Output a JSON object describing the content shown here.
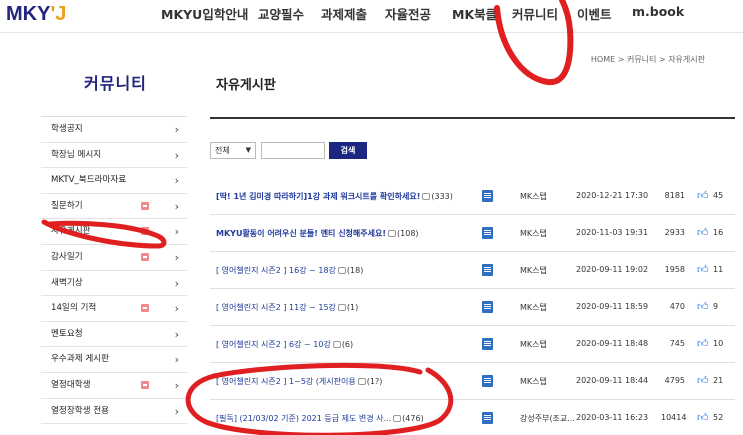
{
  "logo": "MKYU",
  "nav": [
    "MKYU입학안내",
    "교양필수",
    "과제제출",
    "자율전공",
    "MK북클",
    "커뮤니티",
    "이벤트",
    "m.book"
  ],
  "breadcrumb": "HOME > 커뮤니티 > 자유게시판",
  "sidebar": {
    "title": "커뮤니티",
    "items": [
      {
        "label": "학생공지",
        "new": false
      },
      {
        "label": "학장님 메시지",
        "new": false
      },
      {
        "label": "MKTV_북드라마자료",
        "new": false
      },
      {
        "label": "질문하기",
        "new": true
      },
      {
        "label": "자유게시판",
        "new": true
      },
      {
        "label": "감사일기",
        "new": true
      },
      {
        "label": "새벽기상",
        "new": false
      },
      {
        "label": "14일의 기적",
        "new": true
      },
      {
        "label": "멘토요청",
        "new": false
      },
      {
        "label": "우수과제 게시판",
        "new": false
      },
      {
        "label": "열정대학생",
        "new": true
      },
      {
        "label": "열정장학생 전용",
        "new": false
      }
    ]
  },
  "main": {
    "title": "자유게시판",
    "filter": {
      "selected": "전체",
      "search_placeholder": "",
      "search_label": "검색"
    },
    "posts": [
      {
        "title": "[딱! 1년 김미경 따라하기]1강 과제 워크시트를 확인하세요!",
        "comments": "(333)",
        "writer": "MK스탭",
        "date": "2020-12-21 17:30",
        "views": "8181",
        "likes": "45",
        "bold": true
      },
      {
        "title": "MKYU활동이 어려우신 분들! 멘티 신청해주세요!",
        "comments": "(108)",
        "writer": "MK스탭",
        "date": "2020-11-03 19:31",
        "views": "2933",
        "likes": "16",
        "bold": true
      },
      {
        "title": "[ 영어챌린지 시즌2 ] 16강 ~ 18강",
        "comments": "(18)",
        "writer": "MK스탭",
        "date": "2020-09-11 19:02",
        "views": "1958",
        "likes": "11",
        "bold": false
      },
      {
        "title": "[ 영어챌린지 시즌2 ] 11강 ~ 15강",
        "comments": "(1)",
        "writer": "MK스탭",
        "date": "2020-09-11 18:59",
        "views": "470",
        "likes": "9",
        "bold": false
      },
      {
        "title": "[ 영어챌린지 시즌2 ] 6강 ~ 10강",
        "comments": "(6)",
        "writer": "MK스탭",
        "date": "2020-09-11 18:48",
        "views": "745",
        "likes": "10",
        "bold": false
      },
      {
        "title": "[ 영어챌린지 시즌2 ] 1~5강 (게시판이용",
        "comments": "(1?)",
        "writer": "MK스탭",
        "date": "2020-09-11 18:44",
        "views": "4795",
        "likes": "21",
        "bold": false
      },
      {
        "title": "[필독] (21/03/02 기준) 2021 등급 제도 변경 사...",
        "comments": "(476)",
        "writer": "강성주부(조교...",
        "date": "2020-03-11 16:23",
        "views": "10414",
        "likes": "52",
        "bold": false
      }
    ]
  },
  "colors": {
    "brand": "#23247e",
    "accent": "#e8a21a",
    "link": "#1f3a9c",
    "annotation": "#e02020"
  }
}
